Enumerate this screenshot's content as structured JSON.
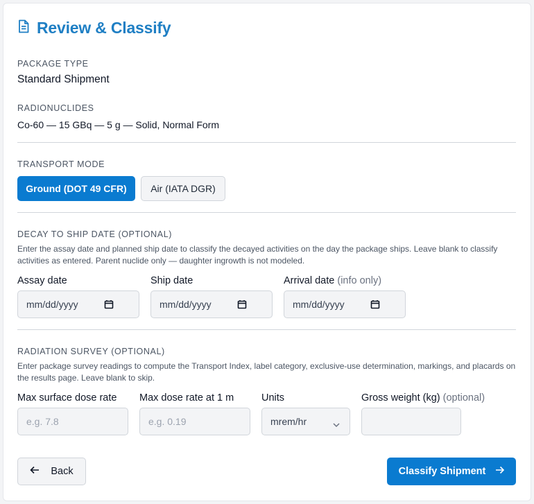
{
  "header": {
    "title": "Review & Classify",
    "icon": "document-icon"
  },
  "package": {
    "label": "PACKAGE TYPE",
    "value": "Standard Shipment"
  },
  "radionuclides": {
    "label": "RADIONUCLIDES",
    "value": "Co-60 — 15 GBq — 5 g — Solid, Normal Form"
  },
  "transport": {
    "label": "TRANSPORT MODE",
    "options": [
      {
        "label": "Ground (DOT 49 CFR)",
        "selected": true
      },
      {
        "label": "Air (IATA DGR)",
        "selected": false
      }
    ]
  },
  "decay": {
    "label": "DECAY TO SHIP DATE (OPTIONAL)",
    "help": "Enter the assay date and planned ship date to classify the decayed activities on the day the package ships. Leave blank to classify activities as entered. Parent nuclide only — daughter ingrowth is not modeled.",
    "assay": {
      "label": "Assay date",
      "value": "mm/dd/yyyy"
    },
    "ship": {
      "label": "Ship date",
      "value": "mm/dd/yyyy"
    },
    "arrival": {
      "label": "Arrival date",
      "note": "(info only)",
      "value": "mm/dd/yyyy"
    }
  },
  "survey": {
    "label": "RADIATION SURVEY (OPTIONAL)",
    "help": "Enter package survey readings to compute the Transport Index, label category, exclusive-use determination, markings, and placards on the results page. Leave blank to skip.",
    "max_surface": {
      "label": "Max surface dose rate",
      "placeholder": "e.g. 7.8"
    },
    "max_1m": {
      "label": "Max dose rate at 1 m",
      "placeholder": "e.g. 0.19"
    },
    "units": {
      "label": "Units",
      "value": "mrem/hr"
    },
    "gross_weight": {
      "label": "Gross weight (kg)",
      "note": "(optional)",
      "value": ""
    }
  },
  "actions": {
    "back": "Back",
    "classify": "Classify Shipment"
  },
  "colors": {
    "accent": "#0a7bd0",
    "title": "#1f7fc4"
  }
}
